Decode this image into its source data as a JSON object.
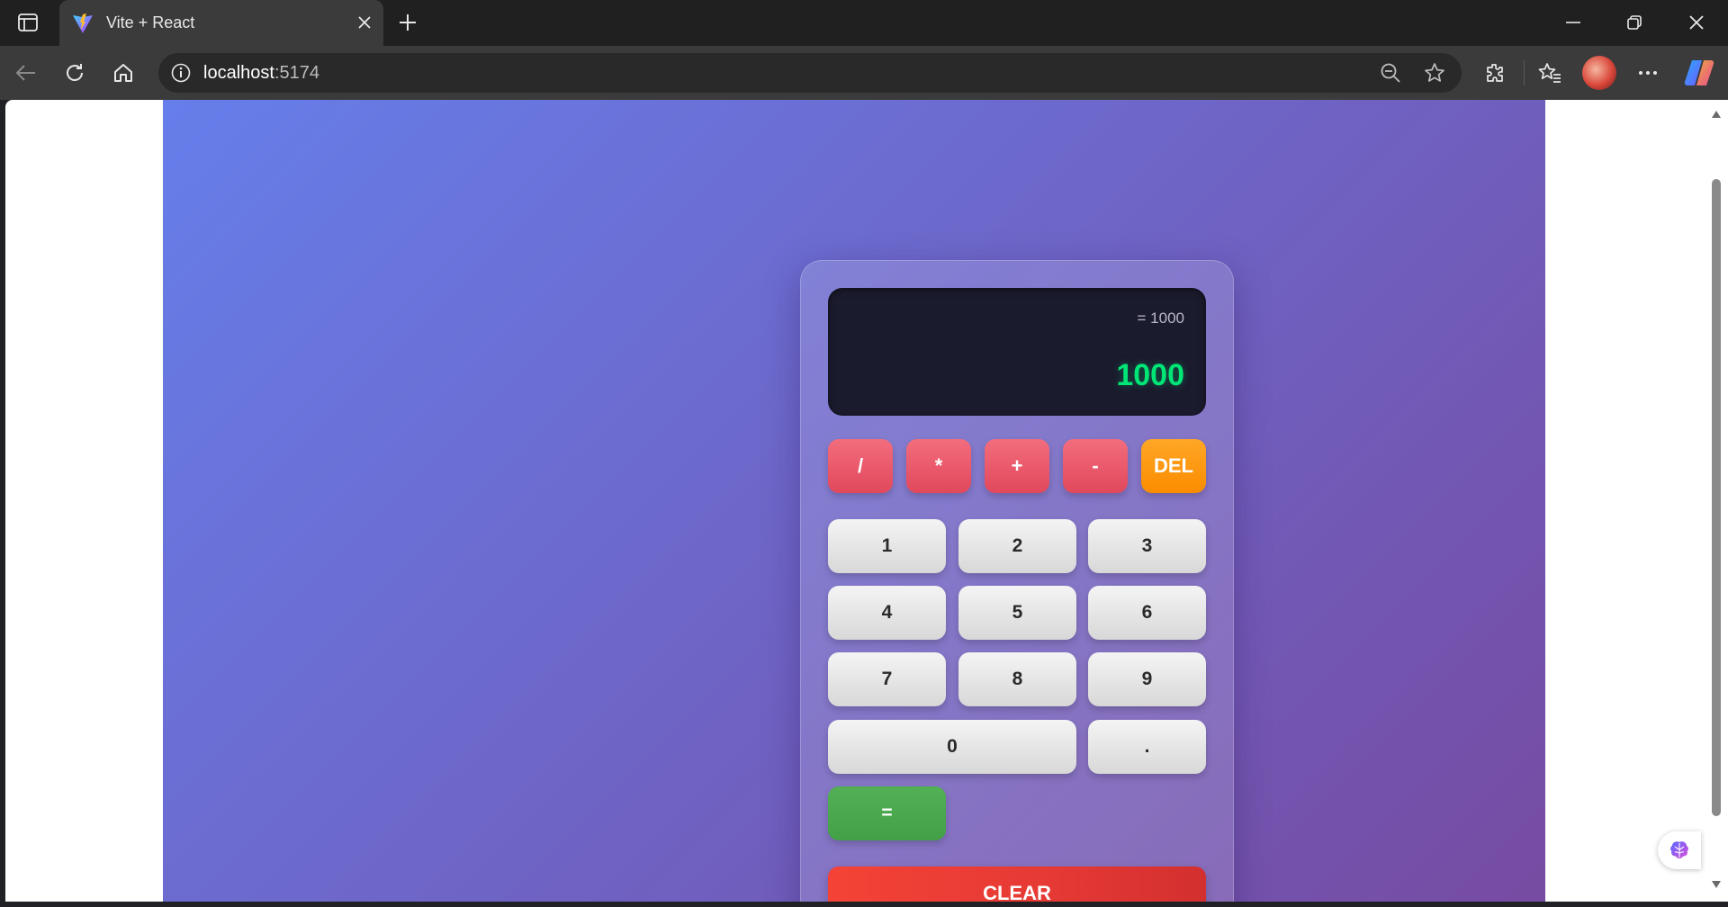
{
  "browser": {
    "tab_title": "Vite + React",
    "url_host": "localhost",
    "url_port": ":5174"
  },
  "calculator": {
    "expression": "= 1000",
    "result": "1000",
    "operators": [
      "/",
      "*",
      "+",
      "-"
    ],
    "delete_label": "DEL",
    "digits": [
      "1",
      "2",
      "3",
      "4",
      "5",
      "6",
      "7",
      "8",
      "9"
    ],
    "zero_label": "0",
    "decimal_label": ".",
    "equals_label": "=",
    "clear_label": "CLEAR"
  },
  "colors": {
    "page_gradient_start": "#667eea",
    "page_gradient_end": "#764ba2",
    "operator": "#e2485c",
    "delete": "#fb8c00",
    "equals": "#43a047",
    "clear": "#e53935",
    "result_text": "#00e676"
  }
}
